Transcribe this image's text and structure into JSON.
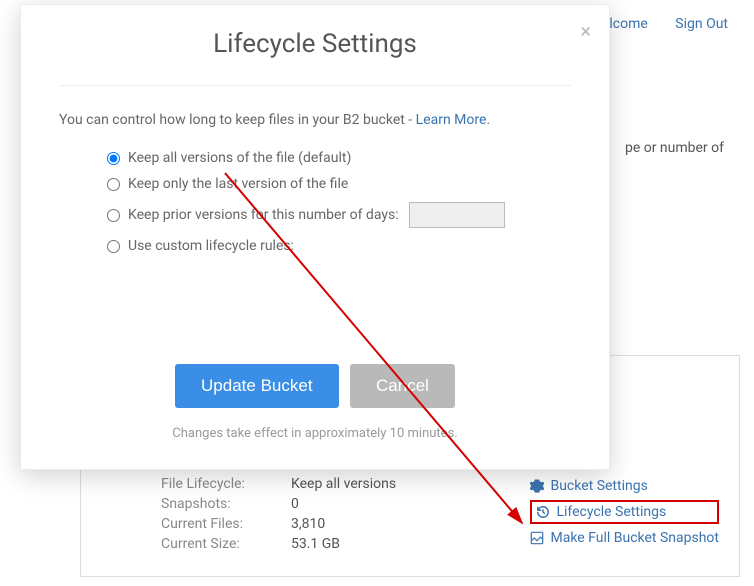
{
  "header": {
    "welcome": "Welcome",
    "signout": "Sign Out"
  },
  "peek_text": "pe or number of",
  "bucket": {
    "rows": [
      {
        "label": "File Lifecycle:",
        "value": "Keep all versions"
      },
      {
        "label": "Snapshots:",
        "value": "0"
      },
      {
        "label": "Current Files:",
        "value": "3,810"
      },
      {
        "label": "Current Size:",
        "value": "53.1 GB"
      }
    ],
    "links": {
      "settings": "Bucket Settings",
      "lifecycle": "Lifecycle Settings",
      "snapshot": "Make Full Bucket Snapshot"
    }
  },
  "modal": {
    "title": "Lifecycle Settings",
    "close": "×",
    "sub_prefix": "You can control how long to keep files in your B2 bucket - ",
    "learn_more": "Learn More",
    "options": {
      "keep_all": "Keep all versions of the file (default)",
      "keep_last": "Keep only the last version of the file",
      "keep_days": "Keep prior versions for this number of days:",
      "custom": "Use custom lifecycle rules:"
    },
    "actions": {
      "update": "Update Bucket",
      "cancel": "Cancel"
    },
    "note": "Changes take effect in approximately 10 minutes."
  }
}
